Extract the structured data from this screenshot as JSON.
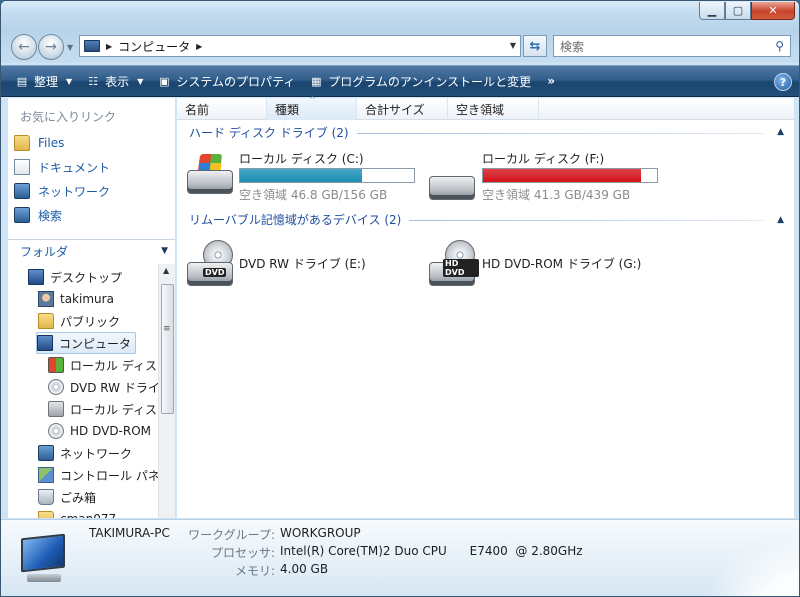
{
  "address": {
    "breadcrumb": "コンピュータ",
    "search_placeholder": "検索"
  },
  "toolbar": {
    "organize": "整理",
    "views": "表示",
    "system_properties": "システムのプロパティ",
    "uninstall": "プログラムのアンインストールと変更",
    "more": "»"
  },
  "favorites": {
    "title": "お気に入りリンク",
    "items": [
      {
        "label": "Files",
        "icon": "folder-icon"
      },
      {
        "label": "ドキュメント",
        "icon": "documents-icon"
      },
      {
        "label": "ネットワーク",
        "icon": "network-icon"
      },
      {
        "label": "検索",
        "icon": "search-icon"
      }
    ]
  },
  "folders": {
    "title": "フォルダ",
    "tree": [
      {
        "label": "デスクトップ",
        "icon": "desktop-icon"
      },
      {
        "label": "takimura",
        "icon": "user-folder-icon"
      },
      {
        "label": "パブリック",
        "icon": "folder-icon"
      },
      {
        "label": "コンピュータ",
        "icon": "computer-icon"
      },
      {
        "label": "ローカル ディスク",
        "icon": "windows-drive-icon"
      },
      {
        "label": "DVD RW ドライ",
        "icon": "dvd-drive-icon"
      },
      {
        "label": "ローカル ディス",
        "icon": "hard-drive-icon"
      },
      {
        "label": "HD DVD-ROM",
        "icon": "hddvd-drive-icon"
      },
      {
        "label": "ネットワーク",
        "icon": "network-icon"
      },
      {
        "label": "コントロール パネ",
        "icon": "control-panel-icon"
      },
      {
        "label": "ごみ箱",
        "icon": "recycle-bin-icon"
      },
      {
        "label": "cman077",
        "icon": "folder-icon"
      }
    ]
  },
  "columns": [
    "名前",
    "種類",
    "合計サイズ",
    "空き領域"
  ],
  "groups": {
    "hdd": {
      "title": "ハード ディスク ドライブ (2)",
      "drives": [
        {
          "name": "ローカル ディスク (C:)",
          "info": "空き領域 46.8 GB/156 GB",
          "used_fraction": 0.7,
          "bar_color": "#1a8fb5"
        },
        {
          "name": "ローカル ディスク (F:)",
          "info": "空き領域 41.3 GB/439 GB",
          "used_fraction": 0.91,
          "bar_color": "#d2121a"
        }
      ]
    },
    "removable": {
      "title": "リムーバブル記憶域があるデバイス (2)",
      "drives": [
        {
          "name": "DVD RW ドライブ (E:)",
          "badge": "DVD"
        },
        {
          "name": "HD DVD-ROM ドライブ (G:)",
          "badge": "HD DVD"
        }
      ]
    }
  },
  "details": {
    "pc_name": "TAKIMURA-PC",
    "workgroup_label": "ワークグループ:",
    "workgroup_value": "WORKGROUP",
    "processor_label": "プロセッサ:",
    "processor_value": "Intel(R) Core(TM)2 Duo CPU      E7400  @ 2.80GHz",
    "memory_label": "メモリ:",
    "memory_value": "4.00 GB"
  }
}
